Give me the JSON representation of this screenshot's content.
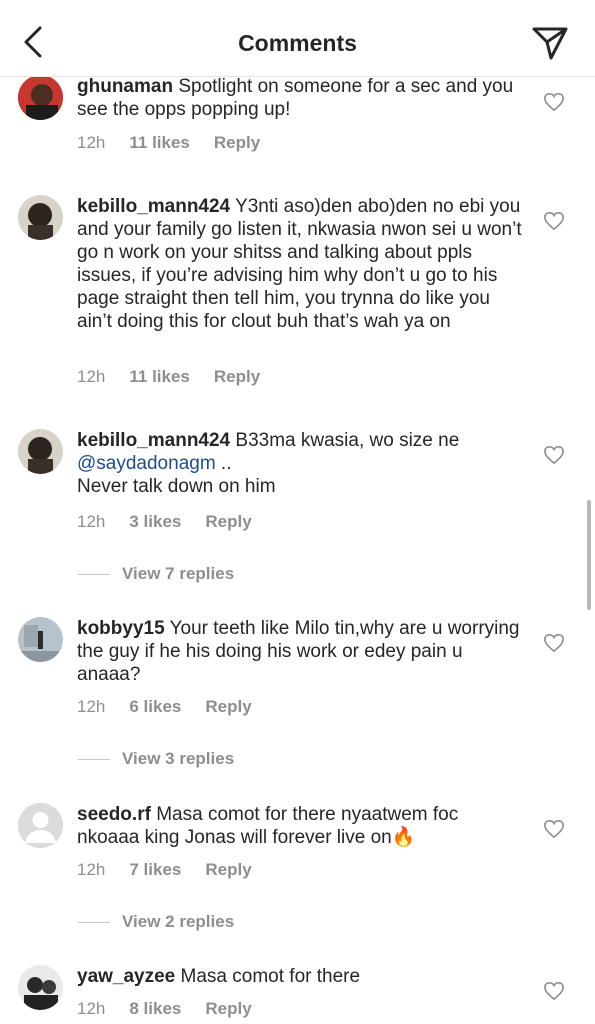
{
  "header": {
    "title": "Comments"
  },
  "comments": [
    {
      "username": "ghunaman",
      "text": "Spotlight on someone for a sec and you see the opps popping up!",
      "time": "12h",
      "likes": "11 likes",
      "reply": "Reply"
    },
    {
      "username": "kebillo_mann424",
      "text": "Y3nti aso)den abo)den no ebi you and your family go listen it, nkwasia nwon sei u won’t go n work on your shitss and talking about ppls issues, if you’re advising him why don’t u go to his page straight then tell him, you trynna do like you ain’t doing this for clout buh that’s wah ya on",
      "time": "12h",
      "likes": "11 likes",
      "reply": "Reply"
    },
    {
      "username": "kebillo_mann424",
      "text": "B33ma kwasia, wo size ne",
      "mention": "@saydadonagm",
      "text_after_mention": " ..",
      "text_line2": "Never talk down on him",
      "time": "12h",
      "likes": "3 likes",
      "reply": "Reply",
      "view_replies": "View 7 replies"
    },
    {
      "username": "kobbyy15",
      "text": "Your teeth like Milo tin,why are u worrying the guy if he his doing his work or edey pain u anaaa?",
      "time": "12h",
      "likes": "6 likes",
      "reply": "Reply",
      "view_replies": "View 3 replies"
    },
    {
      "username": "seedo.rf",
      "text": "Masa comot for there nyaatwem foc nkoaaa king Jonas will forever live on🔥",
      "time": "12h",
      "likes": "7 likes",
      "reply": "Reply",
      "view_replies": "View 2 replies"
    },
    {
      "username": "yaw_ayzee",
      "text": "Masa comot for there",
      "time": "12h",
      "likes": "8 likes",
      "reply": "Reply"
    }
  ],
  "icons": {
    "back": "chevron-left-icon",
    "direct": "paper-plane-icon",
    "like": "heart-outline-icon"
  },
  "colors": {
    "text": "#262626",
    "secondary": "#8e8e8e",
    "mention": "#1f4d8c",
    "divider": "#e6e6e6"
  }
}
